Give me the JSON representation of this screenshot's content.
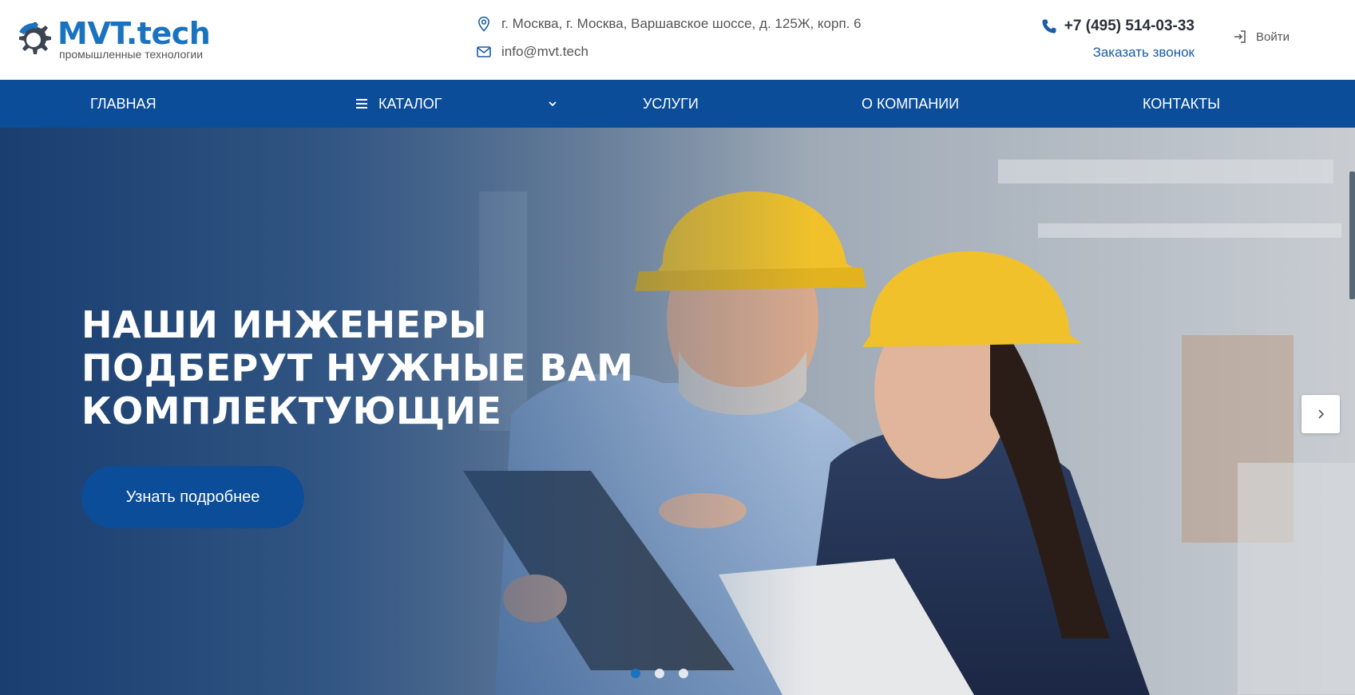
{
  "header": {
    "logo": {
      "name": "MVT.tech",
      "subtitle": "промышленные технологии",
      "icon": "gear-icon"
    },
    "address": {
      "text": "г. Москва, г. Москва, Варшавское шоссе, д. 125Ж, корп. 6",
      "icon": "location-pin-icon"
    },
    "email": {
      "text": "info@mvt.tech",
      "icon": "envelope-icon"
    },
    "phone": {
      "text": "+7 (495) 514-03-33",
      "icon": "phone-icon"
    },
    "callback_label": "Заказать звонок",
    "login": {
      "label": "Войти",
      "icon": "login-icon"
    }
  },
  "nav": {
    "items": [
      {
        "label": "ГЛАВНАЯ"
      },
      {
        "label": "КАТАЛОГ",
        "icon": "menu-icon",
        "chevron": "chevron-down-icon"
      },
      {
        "label": "УСЛУГИ"
      },
      {
        "label": "О КОМПАНИИ"
      },
      {
        "label": "КОНТАКТЫ"
      }
    ]
  },
  "hero": {
    "title_lines": [
      "НАШИ ИНЖЕНЕРЫ",
      "ПОДБЕРУТ НУЖНЫЕ ВАМ",
      "КОМПЛЕКТУЮЩИЕ"
    ],
    "button_label": "Узнать подробнее",
    "slides_total": 3,
    "active_slide": 1,
    "next_icon": "chevron-right-icon"
  },
  "colors": {
    "brand_blue": "#1a73c0",
    "nav_blue": "#0b4d99",
    "callback_link": "#1a5ca8",
    "helmet_yellow": "#f0c12a"
  }
}
